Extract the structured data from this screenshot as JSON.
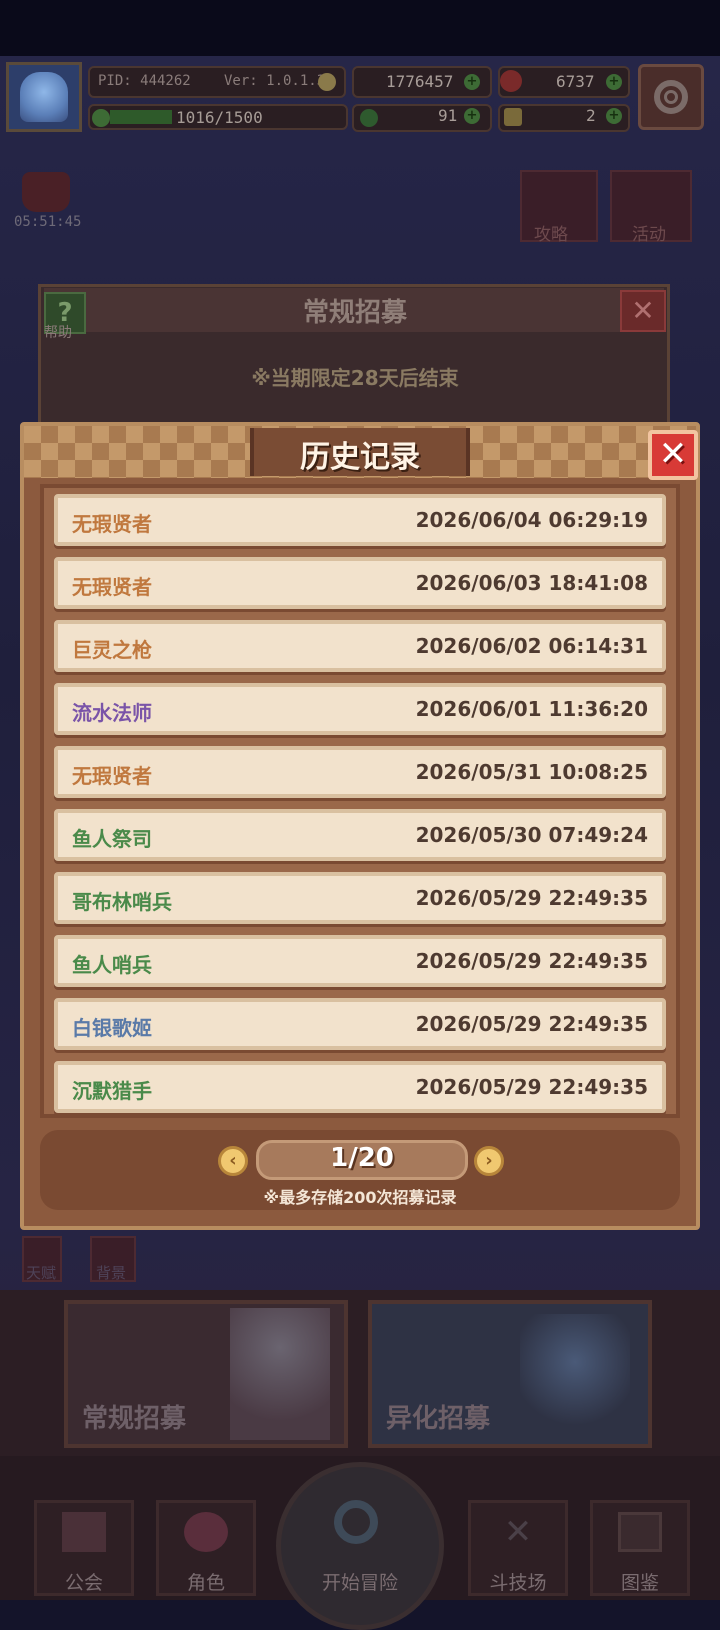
{
  "top_bar": {
    "pid": "PID: 444262",
    "version": "Ver: 1.0.1.3",
    "gold": "1776457",
    "gems": "6737",
    "xp": "1016/1500",
    "clover": "91",
    "tickets": "2"
  },
  "side": {
    "timer": "05:51:45",
    "guide_label": "攻略",
    "event_label": "活动"
  },
  "recruit_dialog": {
    "title": "常规招募",
    "help_label": "帮助",
    "limited_note": "※当期限定28天后结束"
  },
  "history": {
    "title": "历史记录",
    "records": [
      {
        "name": "无瑕贤者",
        "time": "2026/06/04 06:29:19",
        "color": "#c0783e"
      },
      {
        "name": "无瑕贤者",
        "time": "2026/06/03 18:41:08",
        "color": "#c0783e"
      },
      {
        "name": "巨灵之枪",
        "time": "2026/06/02 06:14:31",
        "color": "#c0783e"
      },
      {
        "name": "流水法师",
        "time": "2026/06/01 11:36:20",
        "color": "#7a54a8"
      },
      {
        "name": "无瑕贤者",
        "time": "2026/05/31 10:08:25",
        "color": "#c0783e"
      },
      {
        "name": "鱼人祭司",
        "time": "2026/05/30 07:49:24",
        "color": "#4a8a4a"
      },
      {
        "name": "哥布林哨兵",
        "time": "2026/05/29 22:49:35",
        "color": "#4a8a4a"
      },
      {
        "name": "鱼人哨兵",
        "time": "2026/05/29 22:49:35",
        "color": "#4a8a4a"
      },
      {
        "name": "白银歌姬",
        "time": "2026/05/29 22:49:35",
        "color": "#5a7aa8"
      },
      {
        "name": "沉默猎手",
        "time": "2026/05/29 22:49:35",
        "color": "#4a8a4a"
      }
    ],
    "page": "1/20",
    "note": "※最多存储200次招募记录"
  },
  "bottom": {
    "left_small": "天赋",
    "right_small": "背景",
    "card_regular": "常规招募",
    "card_mutant": "异化招募",
    "nav": [
      "公会",
      "角色",
      "开始冒险",
      "斗技场",
      "图鉴"
    ]
  },
  "colors": {
    "modal_brown": "#8c5a3e",
    "row_bg": "#f2e2cc",
    "close_red": "#d83a36",
    "rarity_legendary": "#c0783e",
    "rarity_epic": "#7a54a8",
    "rarity_rare": "#5a7aa8",
    "rarity_common": "#4a8a4a"
  },
  "icons": [
    "gear-icon",
    "coin-icon",
    "gem-icon",
    "clover-icon",
    "ticket-icon",
    "close-icon",
    "help-icon",
    "arrow-left-icon",
    "arrow-right-icon"
  ]
}
